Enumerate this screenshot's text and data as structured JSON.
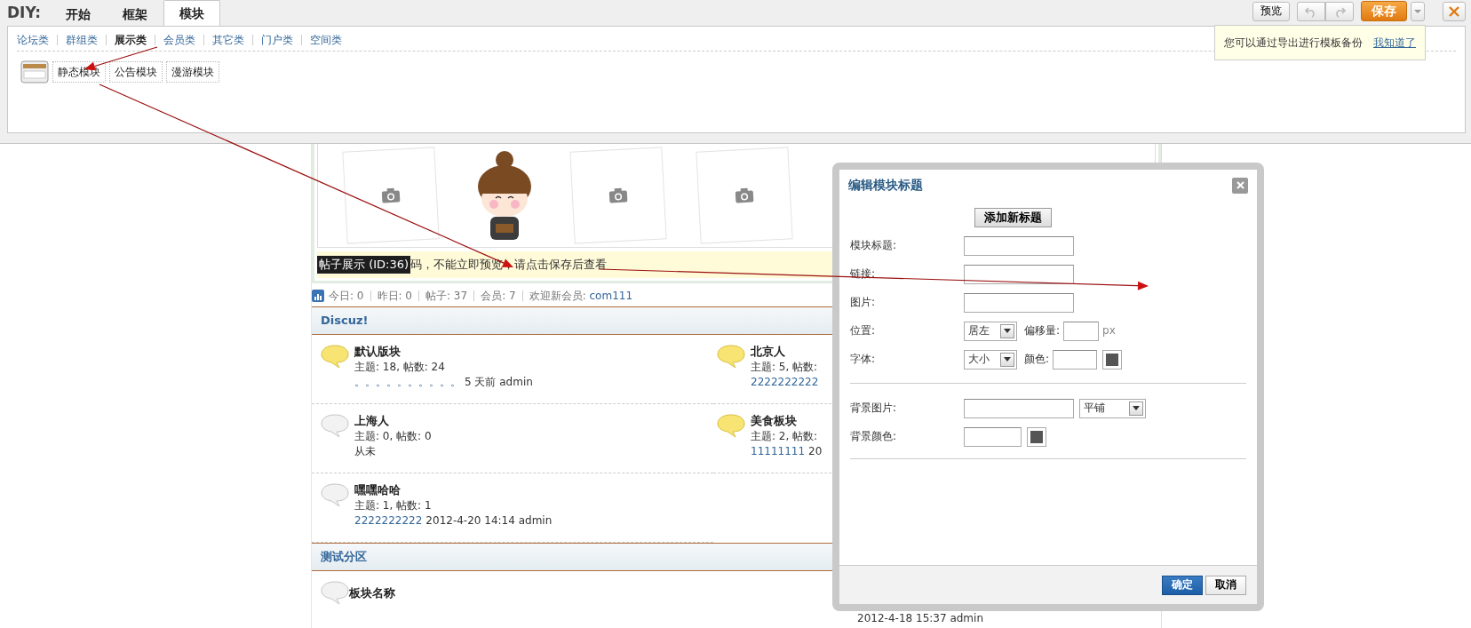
{
  "toolbar": {
    "brand": "DIY:",
    "tabs": [
      {
        "label": "开始",
        "selected": false
      },
      {
        "label": "框架",
        "selected": false
      },
      {
        "label": "模块",
        "selected": true
      }
    ],
    "preview": "预览",
    "save": "保存"
  },
  "categories": [
    {
      "label": "论坛类",
      "selected": false
    },
    {
      "label": "群组类",
      "selected": false
    },
    {
      "label": "展示类",
      "selected": true
    },
    {
      "label": "会员类",
      "selected": false
    },
    {
      "label": "其它类",
      "selected": false
    },
    {
      "label": "门户类",
      "selected": false
    },
    {
      "label": "空间类",
      "selected": false
    }
  ],
  "modules": [
    "静态模块",
    "公告模块",
    "漫游模块"
  ],
  "tip": {
    "text": "您可以通过导出进行模板备份",
    "link": "我知道了"
  },
  "block": {
    "id_label": "帖子展示 (ID:36)",
    "notice": "码，不能立即预览，请点击保存后查看"
  },
  "stats": [
    {
      "label": "今日:",
      "value": "0",
      "kind": "plain"
    },
    {
      "label": "昨日:",
      "value": "0",
      "kind": "plain"
    },
    {
      "label": "帖子:",
      "value": "37",
      "kind": "plain"
    },
    {
      "label": "会员:",
      "value": "7",
      "kind": "plain"
    },
    {
      "label": "欢迎新会员:",
      "value": "com111",
      "kind": "link"
    }
  ],
  "sections": [
    {
      "title": "Discuz!",
      "forums": [
        {
          "name": "默认版块",
          "new": true,
          "stats": "主题: 18, 帖数: 24",
          "last_link": "。。。。。。。。。。",
          "last_meta": "5 天前 admin"
        },
        {
          "name": "北京人",
          "new": true,
          "stats": "主题: 5, 帖数:",
          "last_link": "2222222222"
        },
        {
          "name": "上海人",
          "new": false,
          "stats": "主题: 0, 帖数: 0",
          "last_meta": "从未"
        },
        {
          "name": "美食板块",
          "new": true,
          "stats": "主题: 2, 帖数:",
          "last_link": "11111111",
          "last_meta": "20"
        },
        {
          "name": "嘿嘿哈哈",
          "new": false,
          "stats": "主题: 1, 帖数: 1",
          "last_link": "2222222222",
          "last_meta": "2012-4-20 14:14 admin"
        }
      ]
    },
    {
      "title": "测试分区",
      "forums": [
        {
          "name": "板块名称",
          "new": false,
          "lastpost": "2012-4-18 15:37 admin"
        }
      ]
    }
  ],
  "dialog": {
    "title": "编辑模块标题",
    "add_button": "添加新标题",
    "fields": [
      {
        "label": "模块标题:",
        "kind": "text"
      },
      {
        "label": "链接:",
        "kind": "text"
      },
      {
        "label": "图片:",
        "kind": "text"
      },
      {
        "label": "位置:",
        "kind": "position",
        "select": "居左",
        "offset_label": "偏移量:",
        "unit": "px"
      },
      {
        "label": "字体:",
        "kind": "font",
        "select": "大小",
        "color_label": "颜色:"
      }
    ],
    "background_fields": [
      {
        "label": "背景图片:",
        "kind": "image",
        "select": "平铺"
      },
      {
        "label": "背景颜色:",
        "kind": "color"
      }
    ],
    "ok": "确定",
    "cancel": "取消"
  }
}
